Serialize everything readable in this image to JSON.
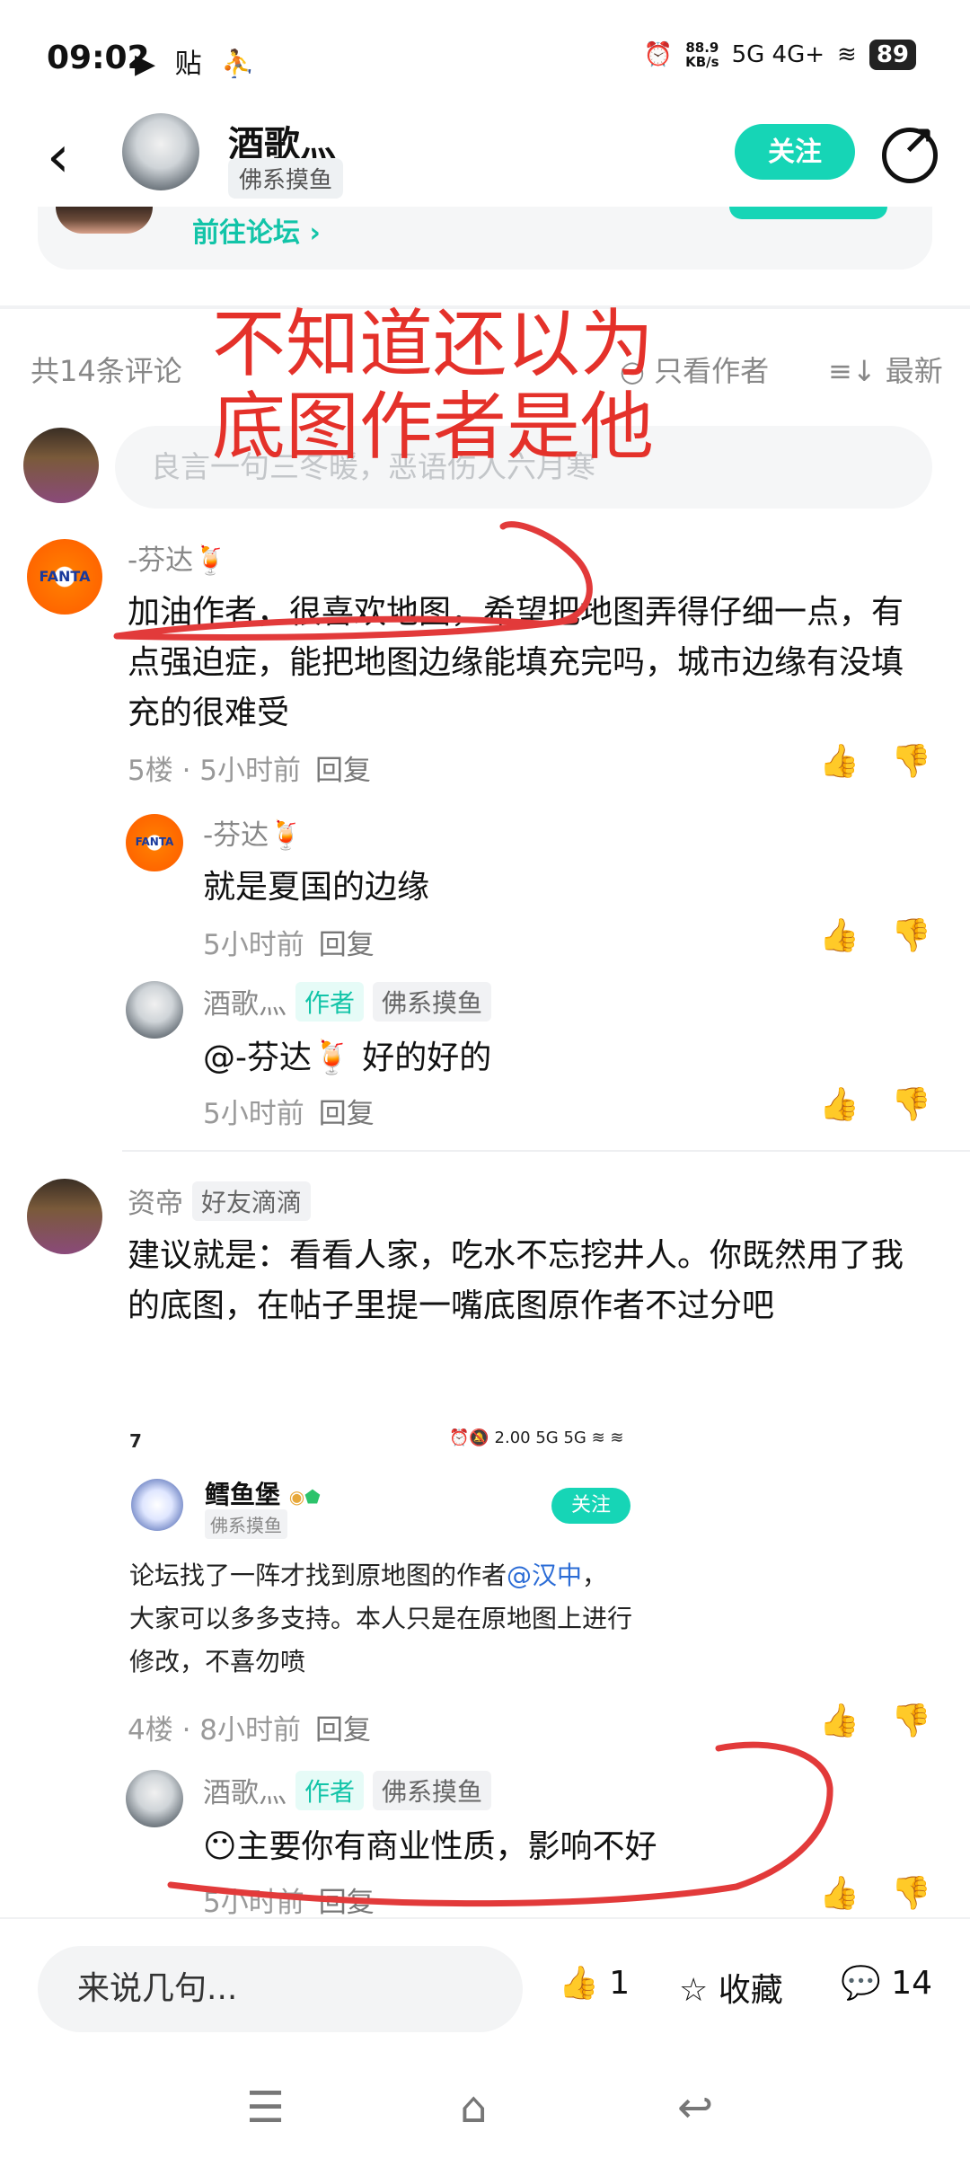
{
  "status_bar": {
    "time": "09:02",
    "left_icons": "▶ 贴 ⛹",
    "net_speed": "88.9",
    "net_unit": "KB/s",
    "signal_labels": "5G 4G+",
    "battery": "89"
  },
  "header": {
    "back_icon": "chevron-left",
    "name": "酒歌灬",
    "tag": "佛系摸鱼",
    "follow_label": "关注",
    "share_icon": "share"
  },
  "forum_card": {
    "link_label": "前往论坛 ›"
  },
  "comments_toolbar": {
    "count_label": "共14条评论",
    "only_author_label": "只看作者",
    "sort_label": "≡↓ 最新"
  },
  "comment_input": {
    "placeholder": "良言一句三冬暖，恶语伤人六月寒"
  },
  "overlay_text": {
    "line1": "不知道还以为",
    "line2": "底图作者是他"
  },
  "comments": [
    {
      "name": "-芬达🍹",
      "avatar_text": "FANTA",
      "body": "加油作者，很喜欢地图，希望把地图弄得仔细一点，有点强迫症，能把地图边缘能填充完吗，城市边缘有没填充的很难受",
      "meta": "5楼 · 5小时前",
      "reply_label": "回复",
      "replies": [
        {
          "name": "-芬达🍹",
          "avatar_text": "FANTA",
          "body": "就是夏国的边缘",
          "meta": "5小时前",
          "reply_label": "回复"
        },
        {
          "name": "酒歌灬",
          "tag_author": "作者",
          "tag": "佛系摸鱼",
          "body": "@-芬达🍹  好的好的",
          "meta": "5小时前",
          "reply_label": "回复"
        }
      ]
    },
    {
      "name": "资帝",
      "tag": "好友滴滴",
      "body": "建议就是：看看人家，吃水不忘挖井人。你既然用了我的底图，在帖子里提一嘴底图原作者不过分吧",
      "embedded": {
        "time": "7",
        "status_icons": "⏰🔕 2.00 5G 5G ≋ ≋",
        "name": "鳕鱼堡",
        "tag": "佛系摸鱼",
        "follow_label": "关注",
        "body_pre": "论坛找了一阵才找到原地图的作者",
        "mention": "@汉中",
        "body_post": "，大家可以多多支持。本人只是在原地图上进行修改，不喜勿喷"
      },
      "meta": "4楼 · 8小时前",
      "reply_label": "回复",
      "replies": [
        {
          "name": "酒歌灬",
          "tag_author": "作者",
          "tag": "佛系摸鱼",
          "body": "😶主要你有商业性质，影响不好",
          "meta": "5小时前",
          "reply_label": "回复"
        }
      ]
    }
  ],
  "bottom_bar": {
    "say_placeholder": "来说几句...",
    "like_count": "1",
    "favorite_label": "收藏",
    "comment_count": "14"
  },
  "colors": {
    "accent": "#16d5b6",
    "overlay_red": "#e4312a"
  }
}
